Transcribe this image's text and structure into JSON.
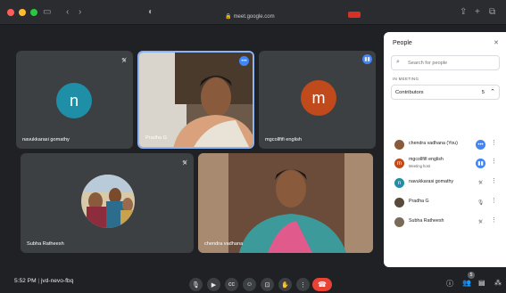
{
  "browser": {
    "url": "meet.google.com"
  },
  "colors": {
    "accent_blue": "#4285f4",
    "end_call_red": "#ea4335",
    "tile_bg": "#3c4043"
  },
  "tiles": [
    {
      "name": "navukkarasi gomathy",
      "initial": "n",
      "avatar_color": "#1e8fa6"
    },
    {
      "name": "Pradha G"
    },
    {
      "name": "mgcollfifi english",
      "initial": "m",
      "avatar_color": "#c04a1c"
    },
    {
      "name": "Subha Ratheesh"
    },
    {
      "name": "chendra vadhana"
    }
  ],
  "bottom_bar": {
    "time": "5:52 PM",
    "meeting_code": "jvd-nevo-fbq",
    "badge_count": "5"
  },
  "panel": {
    "title": "People",
    "search_placeholder": "Search for people",
    "section_label": "IN MEETING",
    "group_label": "Contributors",
    "group_count": "5",
    "participants": [
      {
        "name": "chendra vadhana (You)",
        "sub": ""
      },
      {
        "name": "mgcollfifi english",
        "sub": "Meeting host"
      },
      {
        "name": "navukkarasi gomathy",
        "sub": ""
      },
      {
        "name": "Pradha G",
        "sub": ""
      },
      {
        "name": "Subha Ratheesh",
        "sub": ""
      }
    ]
  }
}
